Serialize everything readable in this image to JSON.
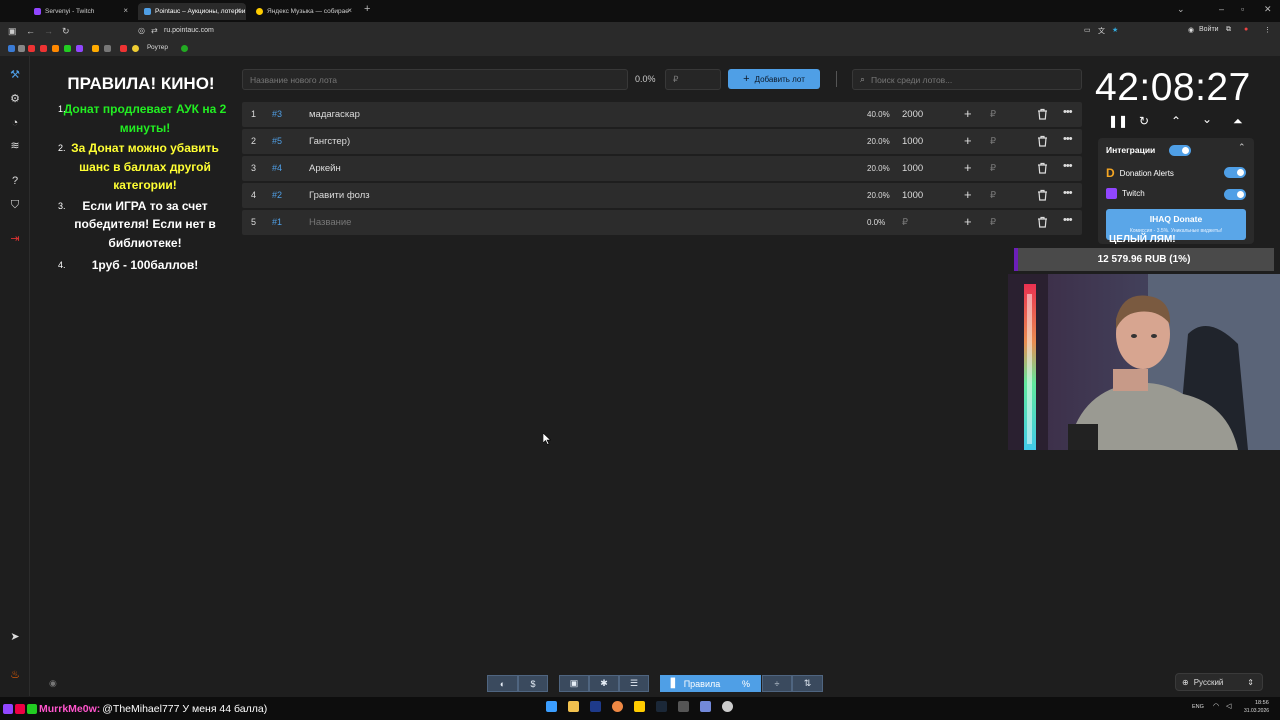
{
  "browser": {
    "tabs": [
      {
        "label": "Servenyi - Twitch",
        "color": "#9146ff"
      },
      {
        "label": "Pointauc – Аукционы, лотереи",
        "color": "#4f9fe6"
      },
      {
        "label": "Яндекс Музыка — собирае",
        "color": "#ffcc00"
      }
    ],
    "url": "ru.pointauc.com",
    "login_label": "Войти",
    "router_bookmark": "Роутер"
  },
  "rules": {
    "title": "ПРАВИЛА! КИНО!",
    "items": [
      {
        "num": "1.",
        "text": "Донат продлевает АУК на 2 минуты!",
        "color": "green"
      },
      {
        "num": "2.",
        "text": "За Донат можно убавить шанс в баллах другой категории!",
        "color": "yellow"
      },
      {
        "num": "3.",
        "text": "Если ИГРА то за счет победителя! Если нет в библиотеке!",
        "color": "white"
      },
      {
        "num": "4.",
        "text": "1руб - 100баллов!",
        "color": "white"
      }
    ]
  },
  "entry": {
    "name_placeholder": "Название нового лота",
    "percent": "0.0%",
    "amount_placeholder": "₽",
    "add_button": "Добавить лот",
    "search_placeholder": "Поиск среди лотов..."
  },
  "lots": [
    {
      "index": "1",
      "id": "#3",
      "name": "мадагаскар",
      "percent": "40.0%",
      "amount": "2000",
      "currency": "₽"
    },
    {
      "index": "2",
      "id": "#5",
      "name": "Гангстер)",
      "percent": "20.0%",
      "amount": "1000",
      "currency": "₽"
    },
    {
      "index": "3",
      "id": "#4",
      "name": "Аркейн",
      "percent": "20.0%",
      "amount": "1000",
      "currency": "₽"
    },
    {
      "index": "4",
      "id": "#2",
      "name": "Гравити фолз",
      "percent": "20.0%",
      "amount": "1000",
      "currency": "₽"
    },
    {
      "index": "5",
      "id": "#1",
      "name": "Название",
      "percent": "0.0%",
      "amount": "₽",
      "currency": "₽",
      "placeholder": true
    }
  ],
  "timer": {
    "value": "42:08:27"
  },
  "integrations": {
    "title": "Интеграции",
    "items": [
      {
        "label": "Donation Alerts",
        "enabled": true
      },
      {
        "label": "Twitch",
        "enabled": true
      }
    ],
    "donate_label": "IHAQ Donate",
    "donate_sub": "Комиссия - 3.5%. Уникальные виджеты!"
  },
  "goal": {
    "title": "ЦЕЛЫЙ ЛЯМ!",
    "progress_text": "12 579.96 RUB (1%)",
    "progress_fraction": 0.01
  },
  "toolbar": {
    "rules_label": "Правила",
    "language": "Русский"
  },
  "chat": {
    "user": "MurrkMe0w:",
    "message": "@TheMihael777 У меня 44 балла)"
  },
  "tray": {
    "lang": "ENG",
    "time": "18:56",
    "date": "31.03.2026"
  },
  "colors": {
    "accent": "#4f9fe6",
    "rule_green": "#22ee22",
    "rule_yellow": "#ffff33",
    "goal_bar": "#6b1fb8",
    "chat_user": "#ff55cc"
  }
}
